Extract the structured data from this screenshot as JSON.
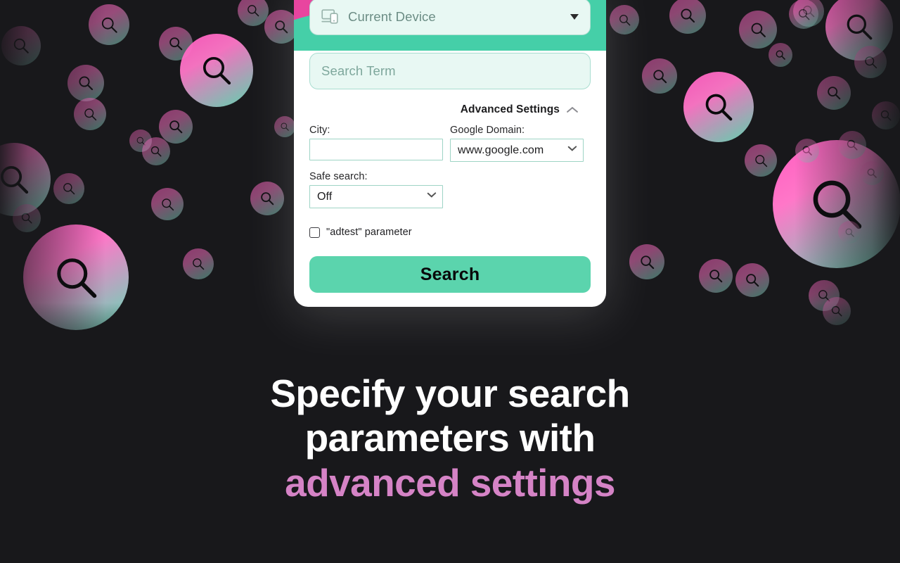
{
  "background": {
    "color": "#18181b",
    "icon": "magnifier-icon",
    "gradient_from": "#ff5cc0",
    "gradient_to": "#62dcb6"
  },
  "popup": {
    "device_select": {
      "icon": "device-screen-icon",
      "value": "Current Device",
      "caret_icon": "caret-down-icon"
    },
    "search_term": {
      "value": "",
      "placeholder": "Search Term"
    },
    "advanced_toggle": {
      "label": "Advanced Settings",
      "icon": "chevron-up-icon",
      "expanded": true
    },
    "fields": {
      "city": {
        "label": "City:",
        "value": "",
        "placeholder": ""
      },
      "google_domain": {
        "label": "Google Domain:",
        "value": "www.google.com",
        "options": [
          "www.google.com"
        ],
        "icon": "chevron-down-icon"
      },
      "safe_search": {
        "label": "Safe search:",
        "value": "Off",
        "options": [
          "Off"
        ],
        "icon": "chevron-down-icon"
      }
    },
    "adtest": {
      "label": "\"adtest\" parameter",
      "checked": false
    },
    "search_button": {
      "label": "Search",
      "color": "#5bd4ad"
    }
  },
  "headline": {
    "line1": "Specify your search",
    "line2": "parameters with",
    "line3": "advanced settings",
    "accent_color": "#d583c6",
    "color": "#ffffff"
  }
}
